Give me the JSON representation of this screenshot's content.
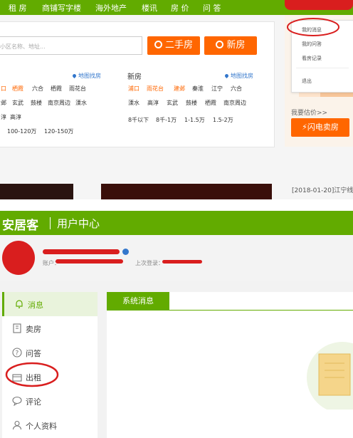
{
  "top": {
    "nav": [
      "租 房",
      "商铺写字楼",
      "海外地产",
      "楼讯",
      "房 价",
      "问 答"
    ],
    "search_placeholder": "小区名称、地址...",
    "btn_ershou": "二手房",
    "btn_xinfang": "新房",
    "map_link": "地图找房",
    "left_col": {
      "row1": [
        {
          "t": "口",
          "o": true
        },
        {
          "t": "栖霞",
          "o": true
        },
        {
          "t": "六合",
          "o": false
        },
        {
          "t": "栖霞",
          "o": false
        },
        {
          "t": "雨花台",
          "o": false
        }
      ],
      "row2": [
        "邺",
        "玄武",
        "鼓楼",
        "南京周边",
        "溧水"
      ],
      "row3": [
        "淳",
        "高淳"
      ],
      "row4": [
        "100-120万",
        "120-150万"
      ]
    },
    "xinfang": {
      "title": "新房",
      "map_link": "地图找房",
      "row1": [
        {
          "t": "浦口",
          "o": true
        },
        {
          "t": "雨花台",
          "o": true
        },
        {
          "t": "建邺",
          "o": true
        },
        {
          "t": "秦淮",
          "o": false
        },
        {
          "t": "江宁",
          "o": false
        },
        {
          "t": "六合",
          "o": false
        }
      ],
      "row2": [
        "溧水",
        "高淳",
        "玄武",
        "鼓楼",
        "栖霞",
        "南京周边"
      ],
      "row3": [
        "8千以下",
        "8千-1万",
        "1-1.5万",
        "1.5-2万"
      ]
    },
    "dropdown": [
      "我的消息",
      "我的问答",
      "看房记录",
      "退出"
    ],
    "estimate": "我要估价>>",
    "flash_btn": "闪电卖房",
    "news": "[2018-01-20]江宁线"
  },
  "bottom": {
    "brand": "安居客",
    "center": "用户中心",
    "account_label": "账户：",
    "last_login_label": "上次登录：",
    "sidebar": [
      {
        "label": "消息",
        "icon": "bell-icon",
        "active": true
      },
      {
        "label": "卖房",
        "icon": "building-icon",
        "active": false
      },
      {
        "label": "问答",
        "icon": "question-icon",
        "active": false
      },
      {
        "label": "出租",
        "icon": "box-icon",
        "active": false
      },
      {
        "label": "评论",
        "icon": "comment-icon",
        "active": false
      },
      {
        "label": "个人资料",
        "icon": "person-icon",
        "active": false
      }
    ],
    "tab": "系统消息"
  },
  "colors": {
    "green": "#62ab00",
    "orange": "#ff6600",
    "red_annot": "#d91e1e"
  }
}
